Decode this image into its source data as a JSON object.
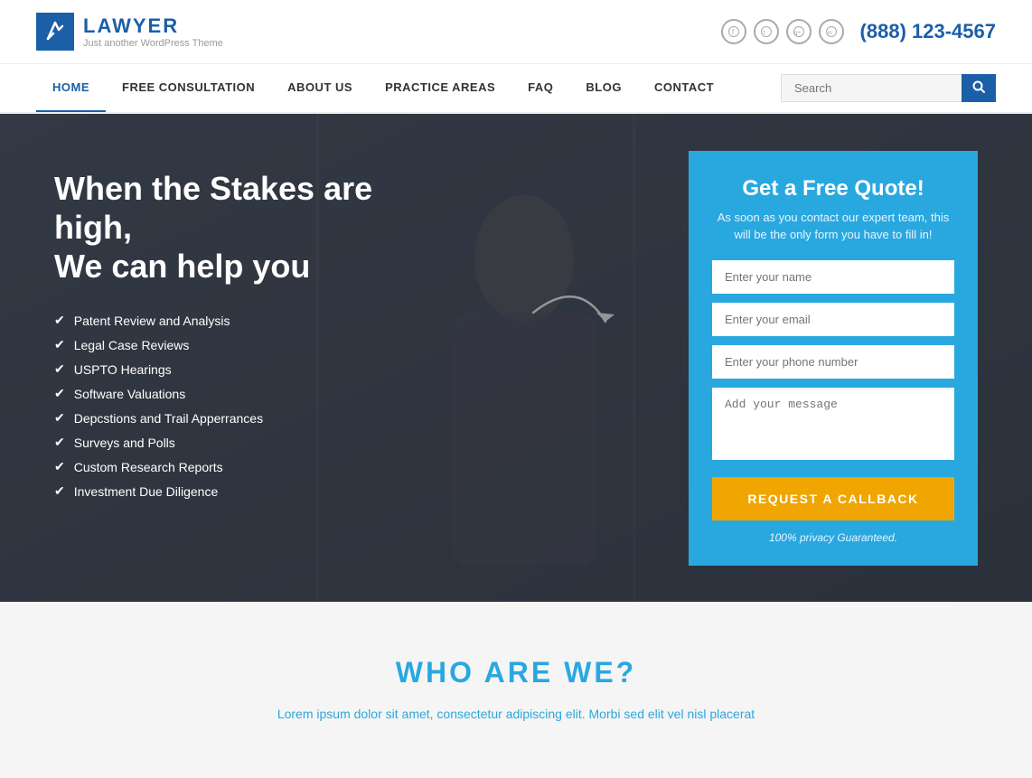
{
  "logo": {
    "title": "LAWYER",
    "subtitle": "Just another WordPress Theme",
    "icon_char": "✒"
  },
  "header": {
    "phone": "(888) 123-4567",
    "social": [
      {
        "name": "facebook",
        "char": "f"
      },
      {
        "name": "twitter",
        "char": "t"
      },
      {
        "name": "googleplus",
        "char": "g+"
      },
      {
        "name": "linkedin",
        "char": "in"
      }
    ]
  },
  "nav": {
    "links": [
      {
        "label": "HOME",
        "active": true
      },
      {
        "label": "FREE CONSULTATION",
        "active": false
      },
      {
        "label": "ABOUT US",
        "active": false
      },
      {
        "label": "PRACTICE AREAS",
        "active": false
      },
      {
        "label": "FAQ",
        "active": false
      },
      {
        "label": "BLOG",
        "active": false
      },
      {
        "label": "CONTACT",
        "active": false
      }
    ],
    "search_placeholder": "Search"
  },
  "hero": {
    "headline": "When the Stakes are high,\nWe can help you",
    "list_items": [
      "Patent Review and Analysis",
      "Legal Case Reviews",
      "USPTO Hearings",
      "Software Valuations",
      "Depcstions and Trail Apperrances",
      "Surveys and Polls",
      "Custom Research Reports",
      "Investment Due Diligence"
    ]
  },
  "quote_form": {
    "title": "Get a Free Quote!",
    "subtitle": "As soon as you contact our expert team, this will be the only form you have to fill in!",
    "name_placeholder": "Enter your name",
    "email_placeholder": "Enter your email",
    "phone_placeholder": "Enter your phone number",
    "message_placeholder": "Add your message",
    "button_label": "REQUEST A CALLBACK",
    "privacy_text": "100% privacy Guaranteed."
  },
  "who_section": {
    "title": "WHO ARE WE?",
    "text": "Lorem ipsum dolor sit amet, consectetur adipiscing elit. Morbi sed ",
    "highlight": "elit",
    "text_end": " vel nisl placerat"
  }
}
